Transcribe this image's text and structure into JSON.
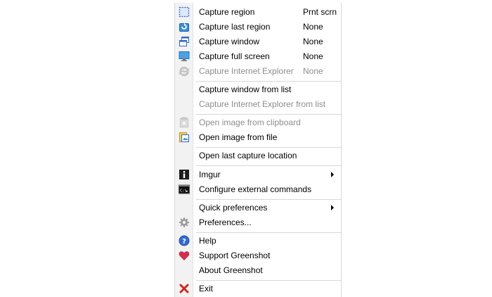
{
  "menu": {
    "items": [
      {
        "icon": "capture-region-icon",
        "label": "Capture region",
        "shortcut": "Prnt scrn"
      },
      {
        "icon": "capture-last-region-icon",
        "label": "Capture last region",
        "shortcut": "None"
      },
      {
        "icon": "capture-window-icon",
        "label": "Capture window",
        "shortcut": "None"
      },
      {
        "icon": "capture-full-screen-icon",
        "label": "Capture full screen",
        "shortcut": "None"
      },
      {
        "icon": "internet-explorer-icon",
        "label": "Capture Internet Explorer",
        "shortcut": "None",
        "disabled": true
      },
      {
        "label": "Capture window from list"
      },
      {
        "label": "Capture Internet Explorer from list",
        "disabled": true
      },
      {
        "icon": "clipboard-icon",
        "label": "Open image from clipboard",
        "disabled": true
      },
      {
        "icon": "open-file-icon",
        "label": "Open image from file"
      },
      {
        "label": "Open last capture location"
      },
      {
        "icon": "imgur-icon",
        "label": "Imgur"
      },
      {
        "icon": "command-prompt-icon",
        "label": "Configure external commands"
      },
      {
        "label": "Quick preferences"
      },
      {
        "icon": "gear-icon",
        "label": "Preferences..."
      },
      {
        "icon": "help-icon",
        "label": "Help"
      },
      {
        "icon": "heart-icon",
        "label": "Support Greenshot"
      },
      {
        "label": "About Greenshot"
      },
      {
        "icon": "exit-icon",
        "label": "Exit"
      }
    ]
  },
  "colors": {
    "help_blue": "#2f6bd6",
    "heart_red": "#d92b4b",
    "exit_red": "#d3241f",
    "disabled_text": "#8d8d8d"
  }
}
